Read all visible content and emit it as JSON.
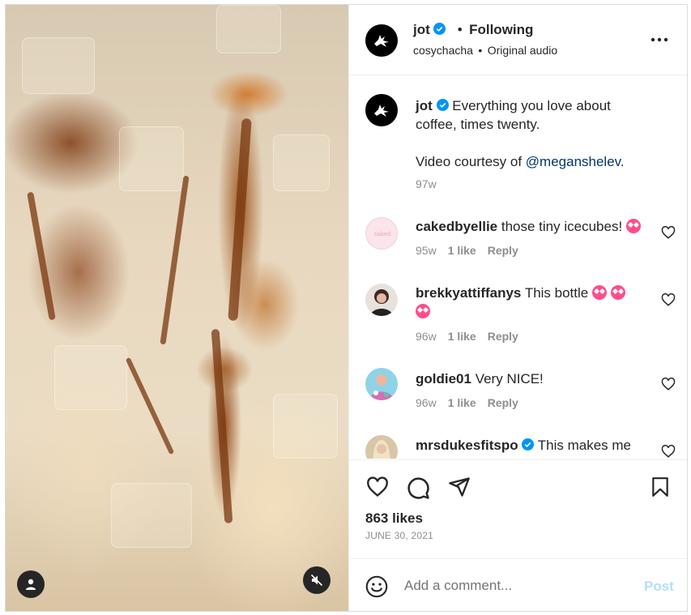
{
  "post": {
    "author": "jot",
    "follow_status": "Following",
    "separator": "•",
    "audio_user": "cosychacha",
    "audio_label": "Original audio",
    "caption_line1": "Everything you love about",
    "caption_line2": "coffee, times twenty.",
    "caption_credit_prefix": "Video courtesy of ",
    "caption_credit_handle": "@meganshelev",
    "caption_credit_suffix": ".",
    "caption_age": "97w",
    "likes": "863 likes",
    "date": "JUNE 30, 2021"
  },
  "comments": [
    {
      "user": "cakedbyellie",
      "text": "those tiny icecubes!",
      "emoji": [
        "heart-eyes"
      ],
      "age": "95w",
      "likes": "1 like",
      "reply": "Reply",
      "avatar_color": "#f7dbe3"
    },
    {
      "user": "brekkyattiffanys",
      "text": "This bottle",
      "emoji": [
        "heart-eyes",
        "heart-eyes",
        "heart-eyes"
      ],
      "age": "96w",
      "likes": "1 like",
      "reply": "Reply",
      "avatar_color": "#3a2a22"
    },
    {
      "user": "goldie01",
      "text": "Very NICE!",
      "emoji": [],
      "age": "96w",
      "likes": "1 like",
      "reply": "Reply",
      "avatar_color": "#c97bb6"
    },
    {
      "user": "mrsdukesfitspo",
      "text": "This makes me want to make an ice coffee right",
      "emoji": [],
      "verified": true,
      "avatar_color": "#d9c5a8"
    }
  ],
  "comment_box": {
    "placeholder": "Add a comment...",
    "post_label": "Post"
  },
  "colors": {
    "accent": "#0095f6",
    "post_disabled": "#b2dffc",
    "verified": "#0095f6",
    "text": "#262626",
    "muted": "#8e8e8e"
  },
  "icons": [
    "more-icon",
    "heart-icon",
    "comment-icon",
    "share-icon",
    "bookmark-icon",
    "smile-icon",
    "user-icon",
    "mute-icon",
    "verified-icon"
  ]
}
